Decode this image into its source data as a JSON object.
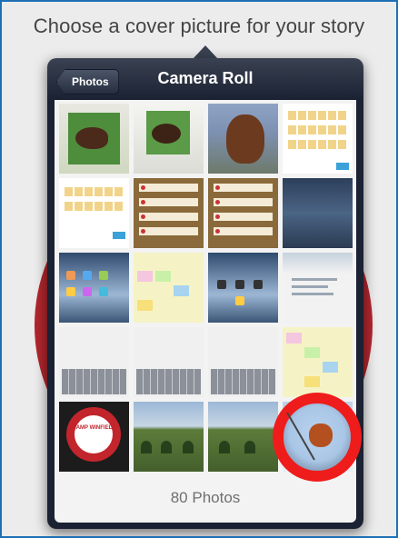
{
  "heading": "Choose a cover picture for your story",
  "nav": {
    "back_label": "Photos",
    "title": "Camera Roll"
  },
  "footer": {
    "count_label": "80 Photos"
  },
  "thumbnails": {
    "logo_text": "CAMP WINFIELD"
  },
  "colors": {
    "frame_border": "#1f6fb5",
    "highlight_circle": "#ef1c1c",
    "background_circle": "#b1262d"
  }
}
